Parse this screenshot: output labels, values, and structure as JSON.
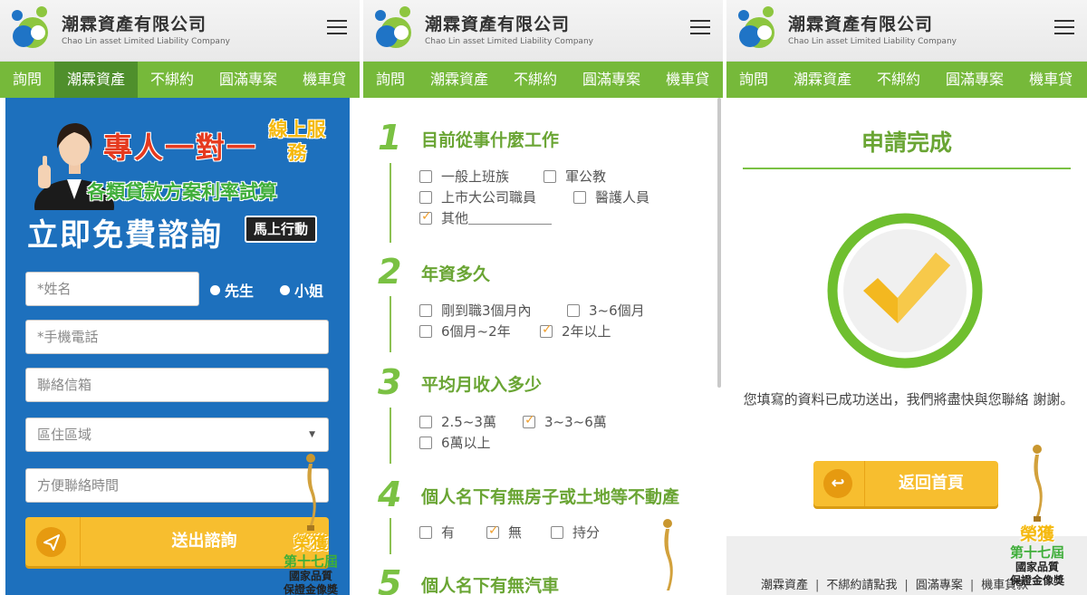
{
  "brand": {
    "name": "潮霖資產有限公司",
    "english": "Chao Lin asset Limited Liability Company"
  },
  "nav": [
    "詢問",
    "潮霖資產",
    "不綁約",
    "圓滿專案",
    "機車貸"
  ],
  "colors": {
    "green": "#76b93a",
    "blue": "#1d70bd",
    "yellow": "#f7be2f"
  },
  "panel1": {
    "banner": {
      "headline": "專人一對一",
      "online": "線上服務",
      "subline": "各類貸款方案利率試算",
      "big": "立即免費諮詢",
      "action": "馬上行動"
    },
    "form": {
      "name_placeholder": "*姓名",
      "gender_mr": "先生",
      "gender_ms": "小姐",
      "phone_placeholder": "*手機電話",
      "email_placeholder": "聯絡信箱",
      "region_placeholder": "區住區域",
      "time_placeholder": "方便聯絡時間",
      "submit": "送出諮詢"
    }
  },
  "award": {
    "line1": "榮獲",
    "line2": "第十七屆",
    "line3": "國家品質",
    "line4": "保證金像獎"
  },
  "panel2": {
    "questions": [
      {
        "num": "1",
        "title": "目前從事什麼工作",
        "options": [
          {
            "label": "一般上班族",
            "checked": false
          },
          {
            "label": "軍公教",
            "checked": false
          },
          {
            "label": "上市大公司職員",
            "checked": false
          },
          {
            "label": "醫護人員",
            "checked": false
          },
          {
            "label": "其他",
            "checked": true
          }
        ]
      },
      {
        "num": "2",
        "title": "年資多久",
        "options": [
          {
            "label": "剛到職3個月內",
            "checked": false
          },
          {
            "label": "3~6個月",
            "checked": false
          },
          {
            "label": "6個月~2年",
            "checked": false
          },
          {
            "label": "2年以上",
            "checked": true
          }
        ]
      },
      {
        "num": "3",
        "title": "平均月收入多少",
        "options": [
          {
            "label": "2.5~3萬",
            "checked": false
          },
          {
            "label": "3~3~6萬",
            "checked": true
          },
          {
            "label": "6萬以上",
            "checked": false
          }
        ]
      },
      {
        "num": "4",
        "title": "個人名下有無房子或土地等不動產",
        "options": [
          {
            "label": "有",
            "checked": false
          },
          {
            "label": "無",
            "checked": true
          },
          {
            "label": "持分",
            "checked": false
          }
        ]
      },
      {
        "num": "5",
        "title": "個人名下有無汽車",
        "options": []
      }
    ]
  },
  "panel3": {
    "title": "申請完成",
    "message": "您填寫的資料已成功送出，我們將盡快與您聯絡 謝謝。",
    "home_button": "返回首頁",
    "footer_links": [
      "潮霖資產",
      "不綁約請點我",
      "圓滿專案",
      "機車貸款"
    ]
  }
}
